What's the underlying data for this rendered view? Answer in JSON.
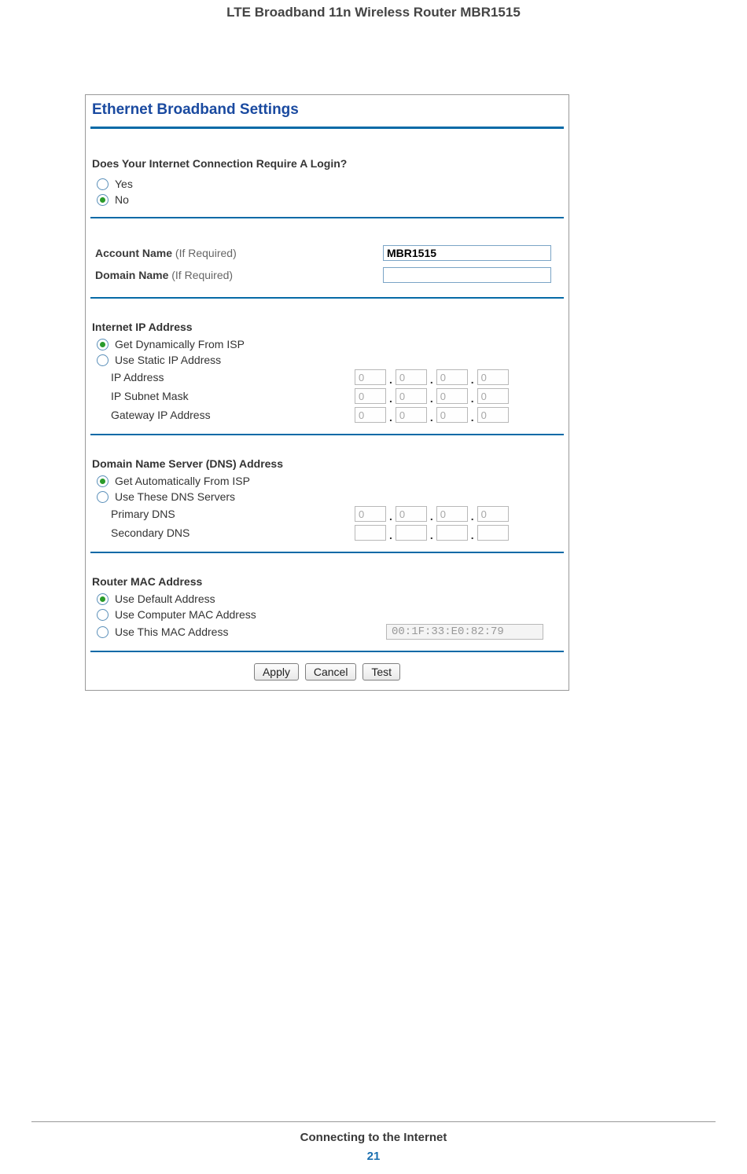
{
  "doc": {
    "header": "LTE Broadband 11n Wireless Router MBR1515",
    "footer": "Connecting to the Internet",
    "page_number": "21"
  },
  "panel": {
    "title": "Ethernet Broadband Settings",
    "login_question": "Does Your Internet Connection Require A Login?",
    "login_yes": "Yes",
    "login_no": "No",
    "account_name_label": "Account Name",
    "if_required": "(If Required)",
    "account_name_value": "MBR1515",
    "domain_name_label": "Domain Name",
    "domain_name_value": "",
    "ip_section": "Internet IP Address",
    "ip_opt_dyn": "Get Dynamically From ISP",
    "ip_opt_static": "Use Static IP Address",
    "ip_address_label": "IP Address",
    "ip_subnet_label": "IP Subnet Mask",
    "gateway_label": "Gateway IP Address",
    "oct0": "0",
    "dns_section": "Domain Name Server (DNS) Address",
    "dns_opt_auto": "Get Automatically From ISP",
    "dns_opt_manual": "Use These DNS Servers",
    "primary_dns_label": "Primary DNS",
    "secondary_dns_label": "Secondary DNS",
    "mac_section": "Router MAC Address",
    "mac_opt_default": "Use Default Address",
    "mac_opt_computer": "Use Computer MAC Address",
    "mac_opt_this": "Use This MAC Address",
    "mac_value": "00:1F:33:E0:82:79",
    "btn_apply": "Apply",
    "btn_cancel": "Cancel",
    "btn_test": "Test",
    "dot": "."
  }
}
